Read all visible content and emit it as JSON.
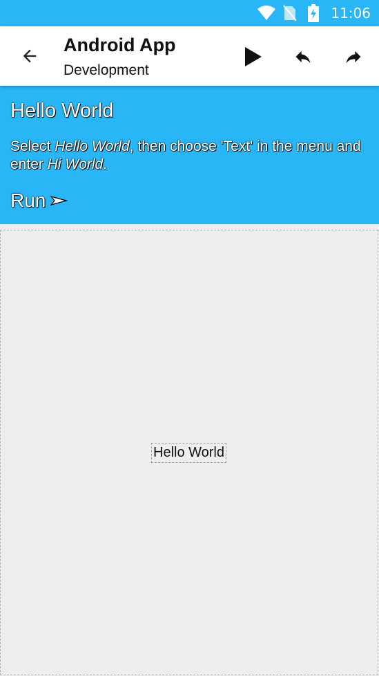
{
  "status_bar": {
    "time": "11:06",
    "icons": [
      "wifi-icon",
      "no-sim-icon",
      "battery-charging-icon"
    ]
  },
  "app_bar": {
    "title": "Android App",
    "subtitle": "Development",
    "actions": [
      "play-icon",
      "undo-icon",
      "redo-icon"
    ]
  },
  "instructions": {
    "heading": "Hello World",
    "text_part1": "Select ",
    "text_em1": "Hello World",
    "text_part2": ", then choose 'Text' in the menu and enter ",
    "text_em2": "Hi World",
    "text_part3": ".",
    "run_label": "Run",
    "accent_color": "#29b6f6"
  },
  "canvas": {
    "label_text": "Hello World"
  }
}
